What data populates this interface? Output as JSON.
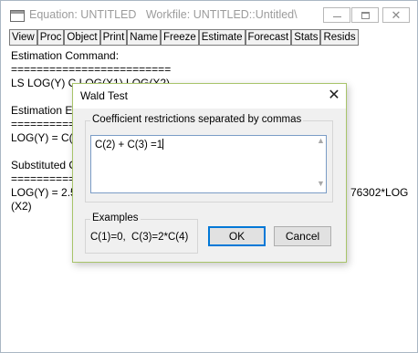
{
  "window": {
    "title": "Equation: UNTITLED   Workfile: UNTITLED::Untitled\\",
    "controls": {
      "minimize": "minimize-icon",
      "maximize": "maximize-icon",
      "close": "close-icon"
    }
  },
  "toolbar": [
    "View",
    "Proc",
    "Object",
    "Print",
    "Name",
    "Freeze",
    "Estimate",
    "Forecast",
    "Stats",
    "Resids"
  ],
  "content": {
    "estimation_command_label": "Estimation Command:",
    "separator": "=========================",
    "command": "LS LOG(Y) C LOG(X1) LOG(X2)",
    "estimation_equation_label": "Estimation E",
    "equation_separator": "===========",
    "equation": "LOG(Y) = C(1",
    "substituted_label": "Substituted C",
    "substituted_separator": "==========",
    "substituted_eq_start": "LOG(Y) = 2.5",
    "substituted_eq_end": "76302*LOG",
    "substituted_eq_wrap": "(X2)"
  },
  "dialog": {
    "title": "Wald Test",
    "restrictions_label": "Coefficient restrictions separated by commas",
    "restrictions_value": "C(2) + C(3) =1",
    "examples_label": "Examples",
    "examples_value": "C(1)=0,  C(3)=2*C(4)",
    "ok_label": "OK",
    "cancel_label": "Cancel",
    "close_glyph": "✕"
  }
}
